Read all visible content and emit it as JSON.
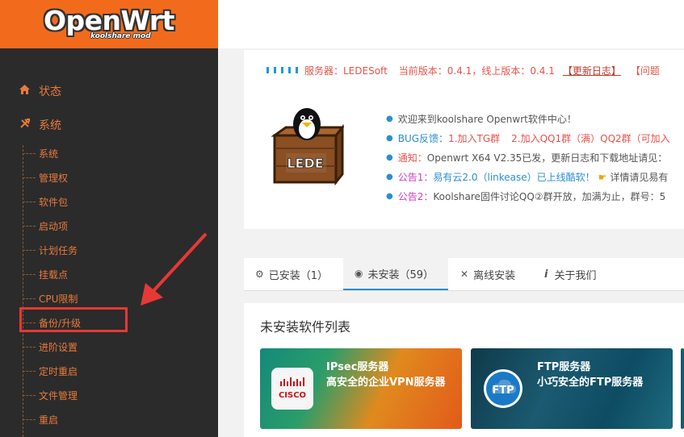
{
  "logo": {
    "title": "OpenWrt",
    "subtitle": "koolshare mod"
  },
  "sidebar": {
    "top_items": [
      {
        "label": "状态",
        "icon": "home-icon"
      },
      {
        "label": "系统",
        "icon": "wrench-icon"
      }
    ],
    "sub_items": [
      {
        "label": "系统"
      },
      {
        "label": "管理权"
      },
      {
        "label": "软件包"
      },
      {
        "label": "启动项"
      },
      {
        "label": "计划任务"
      },
      {
        "label": "挂载点"
      },
      {
        "label": "CPU限制"
      },
      {
        "label": "备份/升级"
      },
      {
        "label": "进阶设置"
      },
      {
        "label": "定时重启"
      },
      {
        "label": "文件管理"
      },
      {
        "label": "重启"
      }
    ],
    "highlighted": "备份/升级"
  },
  "status": {
    "server": "服务器：LEDESoft",
    "current_version": "当前版本：0.4.1，线上版本：0.4.1",
    "changelog": "【更新日志】",
    "problem": "【问题"
  },
  "news": [
    {
      "prefix": "",
      "text": "欢迎来到koolshare Openwrt软件中心！"
    },
    {
      "prefix": "BUG反馈：",
      "text": "1.加入TG群",
      "text2": "2.加入QQ1群（满）QQ2群（可加入"
    },
    {
      "prefix": "通知：",
      "text": "Openwrt X64 V2.35已发，更新日志和下载地址请见："
    },
    {
      "prefix": "公告1：",
      "text": "易有云2.0（linkease）已上线酷软！",
      "text2": "详情请见易有"
    },
    {
      "prefix": "公告2：",
      "text": "Koolshare固件讨论QQ②群开放，加满为止，群号：5"
    }
  ],
  "box_label": "LEDE",
  "tabs": [
    {
      "label": "已安装（1）",
      "icon": "gear-icon"
    },
    {
      "label": "未安装（59）",
      "icon": "globe-icon"
    },
    {
      "label": "离线安装",
      "icon": "tools-icon"
    },
    {
      "label": "关于我们",
      "icon": "info-icon"
    }
  ],
  "list": {
    "title": "未安装软件列表",
    "apps": [
      {
        "name": "IPsec服务器",
        "desc": "高安全的企业VPN服务器",
        "logo_text": "CISCO"
      },
      {
        "name": "FTP服务器",
        "desc": "小巧安全的FTP服务器",
        "logo_text": "FTP"
      }
    ]
  }
}
